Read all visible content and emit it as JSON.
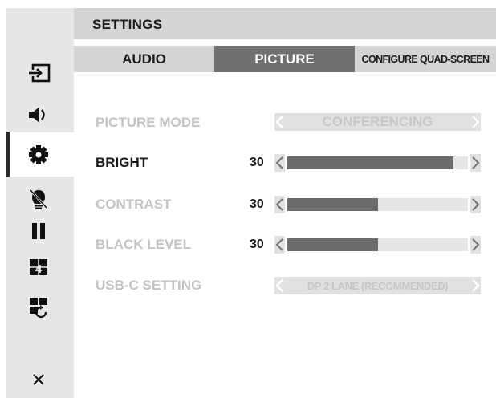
{
  "header": {
    "title": "SETTINGS"
  },
  "tabs": [
    {
      "label": "AUDIO",
      "active": false
    },
    {
      "label": "PICTURE",
      "active": true
    },
    {
      "label": "CONFIGURE QUAD-SCREEN",
      "active": false
    }
  ],
  "sidebar": {
    "items": [
      {
        "icon": "input-source-icon",
        "active": false
      },
      {
        "icon": "speaker-icon",
        "active": false
      },
      {
        "icon": "gear-icon",
        "active": true
      },
      {
        "icon": "no-light-icon",
        "active": false
      },
      {
        "icon": "pause-icon",
        "active": false
      },
      {
        "icon": "quad-view-4-icon",
        "active": false
      },
      {
        "icon": "rotate-layout-icon",
        "active": false
      },
      {
        "icon": "close-icon",
        "active": false
      }
    ]
  },
  "picture": {
    "picture_mode": {
      "label": "PICTURE MODE",
      "value": "CONFERENCING"
    },
    "bright": {
      "label": "BRIGHT",
      "value": "30",
      "level": 0.92
    },
    "contrast": {
      "label": "CONTRAST",
      "value": "30",
      "level": 0.5
    },
    "black_level": {
      "label": "BLACK LEVEL",
      "value": "30",
      "level": 0.5
    },
    "usbc": {
      "label": "USB-C SETTING",
      "value": "DP 2 LANE (RECOMMENDED)"
    }
  },
  "colors": {
    "header_bg": "#d4d4d4",
    "active_tab_bg": "#707070",
    "sidebar_bg": "#e7e7e7",
    "slider_fill": "#6b6b6b",
    "slider_track": "#e6e6e6",
    "inactive_text": "#c3c3c3",
    "active_text": "#1a1a1a"
  }
}
